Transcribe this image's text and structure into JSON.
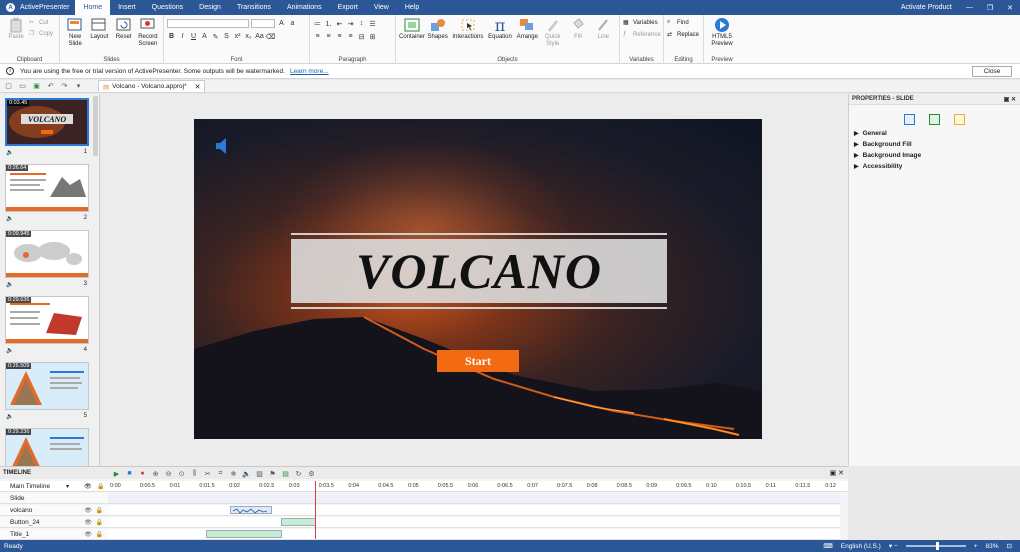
{
  "app": {
    "name": "ActivePresenter"
  },
  "menu": {
    "tabs": [
      "Home",
      "Insert",
      "Questions",
      "Design",
      "Transitions",
      "Animations",
      "Export",
      "View",
      "Help"
    ],
    "active": "Home",
    "activate_product": "Activate Product"
  },
  "ribbon": {
    "clipboard": {
      "paste": "Paste",
      "cut": "Cut",
      "copy": "Copy",
      "label": "Clipboard"
    },
    "slides": {
      "new_slide": "New Slide",
      "layout": "Layout",
      "reset": "Reset",
      "record_screen": "Record Screen",
      "label": "Slides"
    },
    "font": {
      "label": "Font"
    },
    "paragraph": {
      "label": "Paragraph"
    },
    "objects": {
      "container": "Container",
      "shapes": "Shapes",
      "interactions": "Interactions",
      "equation": "Equation",
      "arrange": "Arrange",
      "quick_style": "Quick Style",
      "fill": "Fill",
      "line": "Line",
      "label": "Objects"
    },
    "variables": {
      "variables": "Variables",
      "reference": "Reference",
      "label": "Variables"
    },
    "editing": {
      "find": "Find",
      "replace": "Replace",
      "label": "Editing"
    },
    "preview": {
      "html5": "HTML5 Preview",
      "label": "Preview"
    }
  },
  "infobar": {
    "message": "You are using the free or trial version of ActivePresenter. Some outputs will be watermarked.",
    "link": "Learn more...",
    "close": "Close"
  },
  "document_tab": {
    "title": "Volcano - Volcano.approj*"
  },
  "slides_pane": {
    "thumbnails": [
      {
        "number": "1",
        "time": "0:03.45"
      },
      {
        "number": "2",
        "time": "0:26.64"
      },
      {
        "number": "3",
        "time": "0:09.945"
      },
      {
        "number": "4",
        "time": "0:29.636"
      },
      {
        "number": "5",
        "time": "0:26.509"
      },
      {
        "number": "6",
        "time": "0:29.236"
      }
    ]
  },
  "slide": {
    "title": "VOLCANO",
    "start_button": "Start"
  },
  "properties": {
    "header": "PROPERTIES - SLIDE",
    "sections": [
      "General",
      "Background Fill",
      "Background Image",
      "Accessibility"
    ]
  },
  "timeline": {
    "header": "TIMELINE",
    "main_timeline": "Main Timeline",
    "ticks": [
      "0:00",
      "0:00.5",
      "0:01",
      "0:01.5",
      "0:02",
      "0:02.5",
      "0:03",
      "0:03.5",
      "0:04",
      "0:04.5",
      "0:05",
      "0:05.5",
      "0:06",
      "0:06.5",
      "0:07",
      "0:07.5",
      "0:08",
      "0:08.5",
      "0:09",
      "0:09.5",
      "0:10",
      "0:10.5",
      "0:11",
      "0:11.5",
      "0:12"
    ],
    "rows": [
      "Slide",
      "volcano",
      "Button_24",
      "Title_1"
    ]
  },
  "statusbar": {
    "left": "Ready",
    "language": "English (U.S.)",
    "zoom": "83%"
  },
  "colors": {
    "accent": "#2b5797",
    "start_button": "#f26a12",
    "selection": "#2b79d6"
  }
}
